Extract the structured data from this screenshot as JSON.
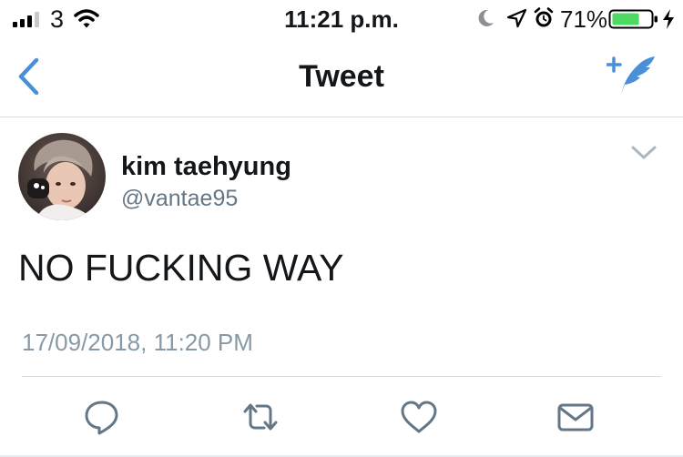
{
  "status_bar": {
    "carrier": "3",
    "time": "11:21 p.m.",
    "battery_percent": "71%",
    "battery_level": 0.71,
    "battery_color": "#4cd964"
  },
  "nav": {
    "title": "Tweet",
    "back_icon": "chevron-left-icon",
    "compose_icon": "compose-tweet-icon",
    "accent_color": "#4a90d9"
  },
  "tweet": {
    "display_name": "kim taehyung",
    "handle": "@vantae95",
    "text": "NO FUCKING WAY",
    "timestamp": "17/09/2018, 11:20 PM"
  },
  "actions": [
    {
      "icon": "reply-icon"
    },
    {
      "icon": "retweet-icon"
    },
    {
      "icon": "like-icon"
    },
    {
      "icon": "direct-message-icon"
    }
  ],
  "colors": {
    "primary_text": "#14171a",
    "secondary_text": "#657786",
    "timestamp_text": "#8899a6",
    "divider": "#d7dbdf",
    "icon_gray": "#657786"
  }
}
